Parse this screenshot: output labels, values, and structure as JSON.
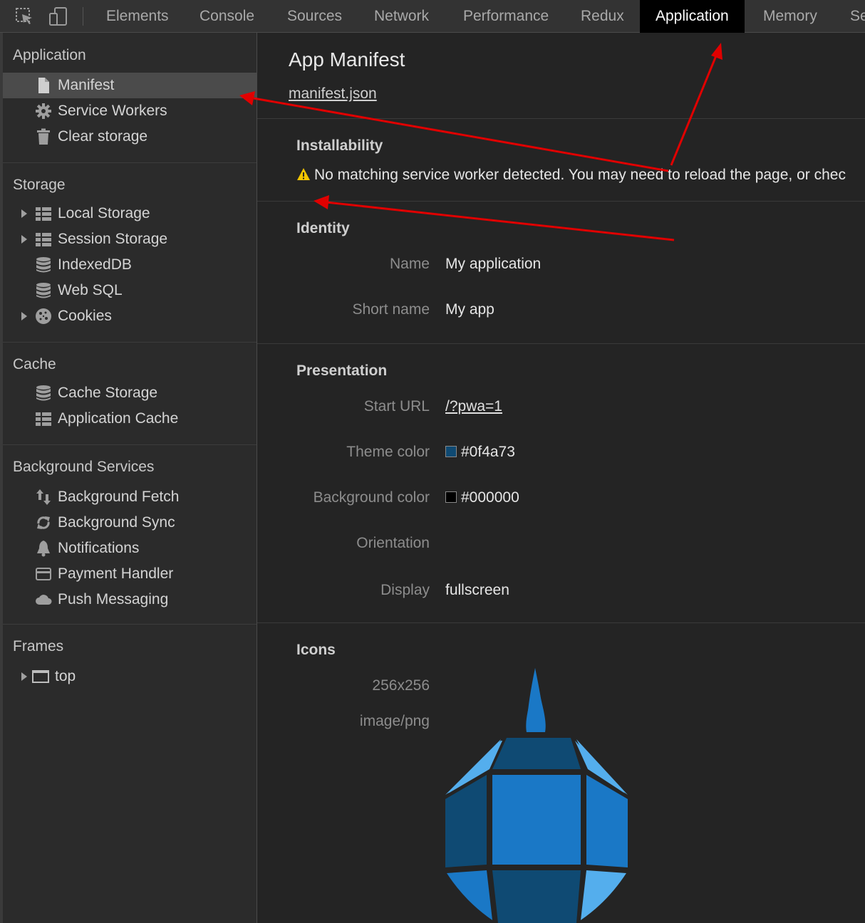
{
  "toolbar": {
    "tabs": [
      {
        "label": "Elements"
      },
      {
        "label": "Console"
      },
      {
        "label": "Sources"
      },
      {
        "label": "Network"
      },
      {
        "label": "Performance"
      },
      {
        "label": "Redux"
      },
      {
        "label": "Application",
        "active": true
      },
      {
        "label": "Memory"
      },
      {
        "label": "Se"
      }
    ],
    "icons": [
      "inspect-element-icon",
      "device-toggle-icon"
    ]
  },
  "sidebar": {
    "sections": [
      {
        "title": "Application",
        "items": [
          {
            "label": "Manifest",
            "icon": "file-icon",
            "selected": true
          },
          {
            "label": "Service Workers",
            "icon": "gear-icon"
          },
          {
            "label": "Clear storage",
            "icon": "trash-icon"
          }
        ]
      },
      {
        "title": "Storage",
        "items": [
          {
            "label": "Local Storage",
            "icon": "grid-icon",
            "expandable": true
          },
          {
            "label": "Session Storage",
            "icon": "grid-icon",
            "expandable": true
          },
          {
            "label": "IndexedDB",
            "icon": "database-icon"
          },
          {
            "label": "Web SQL",
            "icon": "database-icon"
          },
          {
            "label": "Cookies",
            "icon": "cookie-icon",
            "expandable": true
          }
        ]
      },
      {
        "title": "Cache",
        "items": [
          {
            "label": "Cache Storage",
            "icon": "database-icon"
          },
          {
            "label": "Application Cache",
            "icon": "grid-icon"
          }
        ]
      },
      {
        "title": "Background Services",
        "items": [
          {
            "label": "Background Fetch",
            "icon": "up-down-arrows-icon"
          },
          {
            "label": "Background Sync",
            "icon": "sync-icon"
          },
          {
            "label": "Notifications",
            "icon": "bell-icon"
          },
          {
            "label": "Payment Handler",
            "icon": "card-icon"
          },
          {
            "label": "Push Messaging",
            "icon": "cloud-icon"
          }
        ]
      },
      {
        "title": "Frames",
        "items": [
          {
            "label": "top",
            "icon": "frame-icon",
            "expandable": true
          }
        ]
      }
    ]
  },
  "main": {
    "title": "App Manifest",
    "manifest_link": "manifest.json",
    "installability": {
      "heading": "Installability",
      "warning": "No matching service worker detected. You may need to reload the page, or chec"
    },
    "identity": {
      "heading": "Identity",
      "name_label": "Name",
      "name_value": "My application",
      "short_name_label": "Short name",
      "short_name_value": "My app"
    },
    "presentation": {
      "heading": "Presentation",
      "start_url_label": "Start URL",
      "start_url_value": "/?pwa=1",
      "theme_color_label": "Theme color",
      "theme_color_value": "#0f4a73",
      "background_color_label": "Background color",
      "background_color_value": "#000000",
      "orientation_label": "Orientation",
      "orientation_value": "",
      "display_label": "Display",
      "display_value": "fullscreen"
    },
    "icons": {
      "heading": "Icons",
      "size": "256x256",
      "type": "image/png"
    }
  },
  "colors": {
    "annotation_arrow": "#e00000",
    "icon_blue_light": "#54aeed",
    "icon_blue_mid": "#1a78c6",
    "icon_blue_dark": "#0f4a73"
  }
}
